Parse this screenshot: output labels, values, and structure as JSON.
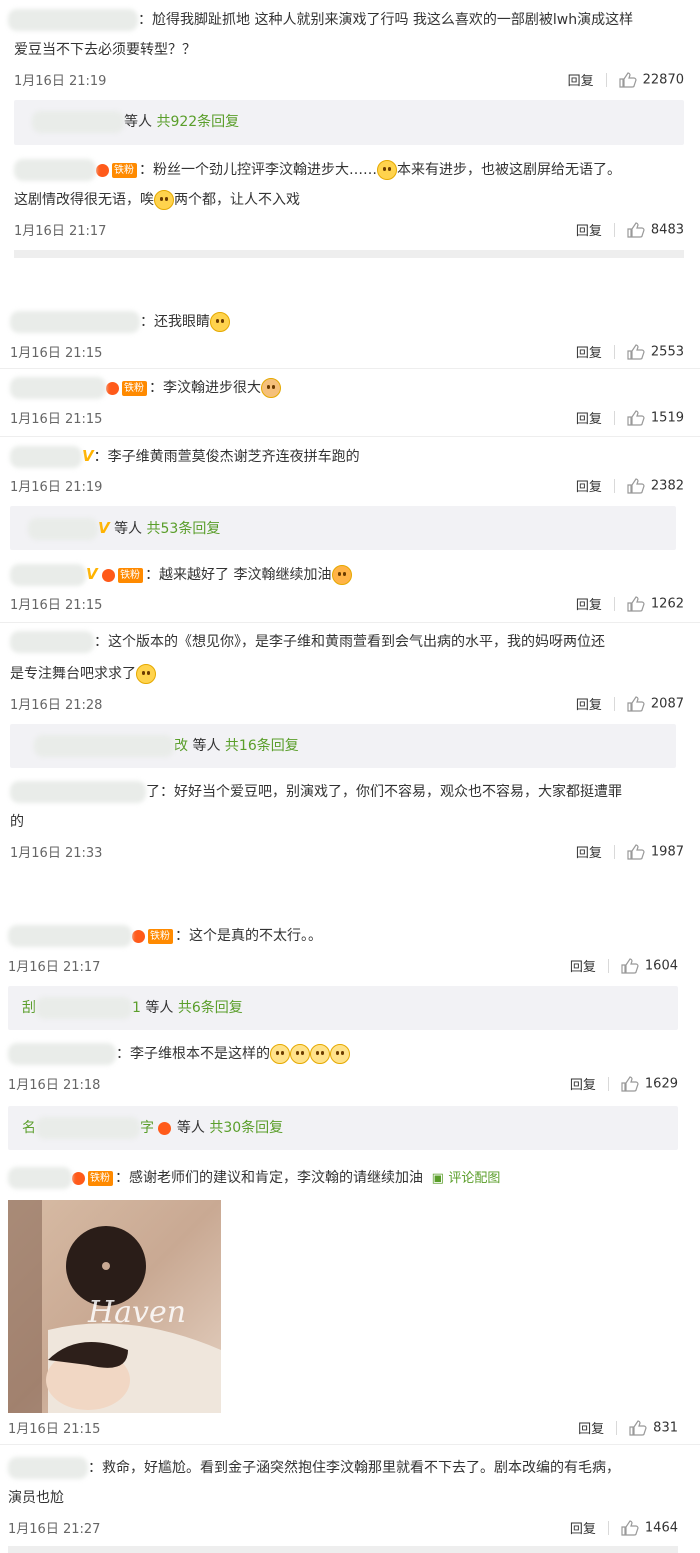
{
  "common": {
    "reply": "回复"
  },
  "c1": {
    "text_line1": "：尬得我脚趾抓地 这种人就别来演戏了行吗 我这么喜欢的一部剧被lwh演成这样",
    "text_line2": "爱豆当不下去必须要转型？？",
    "time": "1月16日 21:19",
    "likes": "22870",
    "reply_suffix": "等人",
    "reply_count": "共922条回复"
  },
  "c2": {
    "badge": "铁粉",
    "text_line1_a": "：粉丝一个劲儿控评李汶翰进步大……",
    "text_line1_b": "本来有进步，也被这剧屏给无语了。",
    "text_line2_a": "这剧情改得很无语，唉",
    "text_line2_b": "两个都，让人不入戏",
    "time": "1月16日 21:17",
    "likes": "8483"
  },
  "c3": {
    "text": "：还我眼睛",
    "time": "1月16日 21:15",
    "likes": "2553"
  },
  "c4": {
    "badge": "铁粉",
    "text": "：李汶翰进步很大",
    "time": "1月16日 21:15",
    "likes": "1519"
  },
  "c5": {
    "vmark": "V",
    "text": "：李子维黄雨萱莫俊杰谢芝齐连夜拼车跑的",
    "time": "1月16日 21:19",
    "likes": "2382",
    "reply_v": "V",
    "reply_suffix": "等人",
    "reply_count": "共53条回复"
  },
  "c6": {
    "vmark": "V",
    "badge": "铁粉",
    "text": "：越来越好了  李汶翰继续加油",
    "time": "1月16日 21:15",
    "likes": "1262"
  },
  "c7": {
    "text_line1": "：这个版本的《想见你》，是李子维和黄雨萱看到会气出病的水平，我的妈呀两位还",
    "text_line2": "是专注舞台吧求求了",
    "time": "1月16日 21:28",
    "likes": "2087",
    "reply_tail": "改",
    "reply_suffix": "等人",
    "reply_count": "共16条回复"
  },
  "c8": {
    "name_tail": "了",
    "text_line1": "：好好当个爱豆吧，别演戏了，你们不容易，观众也不容易，大家都挺遭罪",
    "text_line2": "的",
    "time": "1月16日 21:33",
    "likes": "1987"
  },
  "c9": {
    "badge": "铁粉",
    "text": "：这个是真的不太行。。",
    "time": "1月16日 21:17",
    "likes": "1604",
    "reply_head": "刮",
    "reply_tail": "1",
    "reply_suffix": "等人",
    "reply_count": "共6条回复"
  },
  "c10": {
    "text": "：李子维根本不是这样的",
    "time": "1月16日 21:18",
    "likes": "1629",
    "reply_head": "名",
    "reply_tail": "字",
    "reply_suffix": "等人",
    "reply_count": "共30条回复"
  },
  "c11": {
    "badge": "铁粉",
    "text": "：感谢老师们的建议和肯定，李汶翰的请继续加油",
    "pic_link": "评论配图",
    "photo_script": "Haven",
    "time": "1月16日 21:15",
    "likes": "831"
  },
  "c12": {
    "text_line1": "：救命，好尴尬。看到金子涵突然抱住李汶翰那里就看不下去了。剧本改编的有毛病，",
    "text_line2": "演员也尬",
    "time": "1月16日 21:27",
    "likes": "1464"
  },
  "icons": {
    "like": "thumbs-up-icon",
    "picture": "picture-icon",
    "crown": "crown-icon",
    "emoji": "face-emoji-icon"
  },
  "colors": {
    "reply_count": "#5a9e2a",
    "badge": "#ff8a00",
    "vip": "#ffb300"
  }
}
